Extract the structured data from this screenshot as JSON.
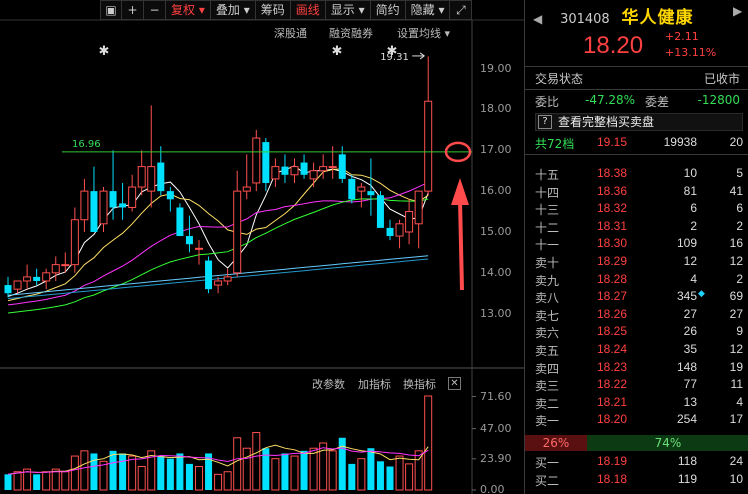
{
  "toolbar": {
    "items": [
      "复权",
      "叠加",
      "筹码",
      "画线",
      "显示",
      "简约",
      "隐藏"
    ],
    "icons": [
      "window-icon",
      "plus-icon",
      "minus-icon",
      "expand-icon"
    ]
  },
  "subbar": {
    "left": [
      "深股通",
      "融资融券"
    ],
    "right": "设置均线"
  },
  "chart": {
    "hline_label": "16.96",
    "high_label": "19.31",
    "price_axis": [
      "19.00",
      "18.00",
      "17.00",
      "16.00",
      "15.00",
      "14.00",
      "13.00"
    ],
    "colors": {
      "up": "#ff5050",
      "down": "#00e0ff",
      "ma5": "#ffffff",
      "ma10": "#ffe066",
      "ma20": "#ff33ff",
      "ma60": "#33ff33",
      "ma120": "#66ccff",
      "hline": "#33cc33",
      "annot": "#ff4b4b"
    }
  },
  "chart_data": {
    "type": "candlestick",
    "title": "",
    "ylim": [
      12.6,
      19.7
    ],
    "hline": 16.96,
    "high": 19.31,
    "candles": [
      {
        "o": 13.7,
        "h": 13.9,
        "l": 13.4,
        "c": 13.5
      },
      {
        "o": 13.6,
        "h": 13.8,
        "l": 13.5,
        "c": 13.8
      },
      {
        "o": 13.8,
        "h": 14.2,
        "l": 13.6,
        "c": 13.9
      },
      {
        "o": 13.9,
        "h": 14.1,
        "l": 13.7,
        "c": 13.8
      },
      {
        "o": 13.8,
        "h": 14.1,
        "l": 13.6,
        "c": 14.0
      },
      {
        "o": 14.0,
        "h": 14.4,
        "l": 13.8,
        "c": 14.2
      },
      {
        "o": 14.2,
        "h": 14.5,
        "l": 14.0,
        "c": 14.2
      },
      {
        "o": 14.2,
        "h": 15.6,
        "l": 14.0,
        "c": 15.3
      },
      {
        "o": 15.3,
        "h": 16.3,
        "l": 15.0,
        "c": 16.0
      },
      {
        "o": 16.0,
        "h": 16.6,
        "l": 15.2,
        "c": 15.0
      },
      {
        "o": 15.2,
        "h": 16.1,
        "l": 15.0,
        "c": 16.0
      },
      {
        "o": 16.0,
        "h": 17.0,
        "l": 15.3,
        "c": 15.6
      },
      {
        "o": 15.7,
        "h": 16.2,
        "l": 15.3,
        "c": 15.6
      },
      {
        "o": 15.6,
        "h": 16.4,
        "l": 15.5,
        "c": 16.1
      },
      {
        "o": 16.1,
        "h": 17.0,
        "l": 15.9,
        "c": 16.6
      },
      {
        "o": 16.0,
        "h": 18.1,
        "l": 15.6,
        "c": 16.6
      },
      {
        "o": 16.7,
        "h": 17.1,
        "l": 15.9,
        "c": 16.0
      },
      {
        "o": 16.0,
        "h": 16.1,
        "l": 15.5,
        "c": 15.8
      },
      {
        "o": 15.6,
        "h": 15.7,
        "l": 14.9,
        "c": 14.9
      },
      {
        "o": 14.9,
        "h": 15.4,
        "l": 14.5,
        "c": 14.7
      },
      {
        "o": 14.6,
        "h": 14.8,
        "l": 14.2,
        "c": 14.6
      },
      {
        "o": 14.3,
        "h": 14.4,
        "l": 13.5,
        "c": 13.6
      },
      {
        "o": 13.7,
        "h": 13.9,
        "l": 13.5,
        "c": 13.8
      },
      {
        "o": 13.8,
        "h": 14.1,
        "l": 13.7,
        "c": 13.9
      },
      {
        "o": 14.0,
        "h": 16.5,
        "l": 13.9,
        "c": 16.0
      },
      {
        "o": 16.0,
        "h": 16.9,
        "l": 15.8,
        "c": 16.1
      },
      {
        "o": 16.2,
        "h": 17.5,
        "l": 16.0,
        "c": 17.3
      },
      {
        "o": 17.2,
        "h": 17.3,
        "l": 16.0,
        "c": 16.2
      },
      {
        "o": 16.3,
        "h": 16.8,
        "l": 16.1,
        "c": 16.6
      },
      {
        "o": 16.6,
        "h": 16.9,
        "l": 16.2,
        "c": 16.4
      },
      {
        "o": 16.4,
        "h": 16.8,
        "l": 16.2,
        "c": 16.6
      },
      {
        "o": 16.7,
        "h": 16.9,
        "l": 16.3,
        "c": 16.4
      },
      {
        "o": 16.3,
        "h": 16.7,
        "l": 16.1,
        "c": 16.5
      },
      {
        "o": 16.5,
        "h": 16.9,
        "l": 16.3,
        "c": 16.6
      },
      {
        "o": 16.6,
        "h": 17.1,
        "l": 16.3,
        "c": 16.6
      },
      {
        "o": 16.9,
        "h": 17.1,
        "l": 16.2,
        "c": 16.3
      },
      {
        "o": 16.3,
        "h": 16.4,
        "l": 15.7,
        "c": 15.8
      },
      {
        "o": 16.0,
        "h": 16.2,
        "l": 15.6,
        "c": 16.1
      },
      {
        "o": 16.0,
        "h": 16.8,
        "l": 15.4,
        "c": 15.9
      },
      {
        "o": 15.9,
        "h": 16.0,
        "l": 15.2,
        "c": 15.1
      },
      {
        "o": 15.1,
        "h": 15.3,
        "l": 14.8,
        "c": 14.9
      },
      {
        "o": 14.9,
        "h": 15.3,
        "l": 14.6,
        "c": 15.2
      },
      {
        "o": 15.0,
        "h": 15.8,
        "l": 14.7,
        "c": 15.5
      },
      {
        "o": 15.2,
        "h": 15.4,
        "l": 14.6,
        "c": 16.0
      },
      {
        "o": 16.0,
        "h": 19.3,
        "l": 15.9,
        "c": 18.2
      }
    ],
    "volume": [
      12,
      14,
      16,
      12,
      14,
      16,
      14,
      26,
      30,
      28,
      22,
      30,
      28,
      26,
      18,
      30,
      26,
      24,
      28,
      20,
      18,
      28,
      12,
      14,
      40,
      32,
      44,
      32,
      24,
      28,
      26,
      30,
      32,
      36,
      30,
      40,
      20,
      24,
      32,
      22,
      18,
      26,
      20,
      30,
      72
    ],
    "volume_axis": [
      "71.60",
      "47.00",
      "23.90",
      "0.00"
    ],
    "volume_ylim": [
      0,
      72
    ]
  },
  "volume_head": {
    "items": [
      "改参数",
      "加指标",
      "换指标"
    ]
  },
  "quote": {
    "code": "301408",
    "name": "华人健康",
    "price": "18.20",
    "change": "+2.11",
    "change_pct": "+13.11%",
    "status_label": "交易状态",
    "status_value": "已收市",
    "weibi_label": "委比",
    "weibi_value": "-47.28%",
    "weicha_label": "委差",
    "weicha_value": "-12800",
    "fullbook": "查看完整档买卖盘",
    "total_label": "共72档",
    "total_price": "19.15",
    "total_vol": "19938",
    "total_orders": "20",
    "asks": [
      {
        "label": "十五",
        "price": "18.38",
        "vol": "10",
        "ord": "5"
      },
      {
        "label": "十四",
        "price": "18.36",
        "vol": "81",
        "ord": "41"
      },
      {
        "label": "十三",
        "price": "18.32",
        "vol": "6",
        "ord": "6"
      },
      {
        "label": "十二",
        "price": "18.31",
        "vol": "2",
        "ord": "2"
      },
      {
        "label": "十一",
        "price": "18.30",
        "vol": "109",
        "ord": "16"
      },
      {
        "label": "卖十",
        "price": "18.29",
        "vol": "12",
        "ord": "12"
      },
      {
        "label": "卖九",
        "price": "18.28",
        "vol": "4",
        "ord": "2"
      },
      {
        "label": "卖八",
        "price": "18.27",
        "vol": "345",
        "ord": "69",
        "dot": true
      },
      {
        "label": "卖七",
        "price": "18.26",
        "vol": "27",
        "ord": "27"
      },
      {
        "label": "卖六",
        "price": "18.25",
        "vol": "26",
        "ord": "9"
      },
      {
        "label": "卖五",
        "price": "18.24",
        "vol": "35",
        "ord": "12"
      },
      {
        "label": "卖四",
        "price": "18.23",
        "vol": "148",
        "ord": "19"
      },
      {
        "label": "卖三",
        "price": "18.22",
        "vol": "77",
        "ord": "11"
      },
      {
        "label": "卖二",
        "price": "18.21",
        "vol": "13",
        "ord": "4"
      },
      {
        "label": "卖一",
        "price": "18.20",
        "vol": "254",
        "ord": "17"
      }
    ],
    "ratio_buy": "26%",
    "ratio_sell": "74%",
    "bids": [
      {
        "label": "买一",
        "price": "18.19",
        "vol": "118",
        "ord": "24"
      },
      {
        "label": "买二",
        "price": "18.18",
        "vol": "119",
        "ord": "10"
      }
    ]
  }
}
